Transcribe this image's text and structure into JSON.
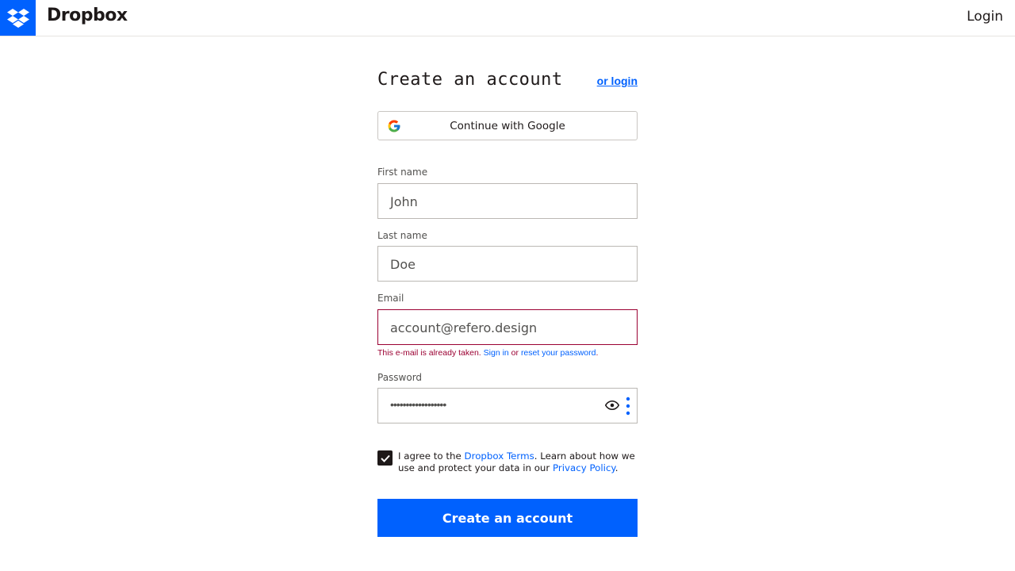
{
  "header": {
    "brand": "Dropbox",
    "login_label": "Login"
  },
  "form": {
    "title": "Create an account",
    "or_login": "or login",
    "google_button": "Continue with Google",
    "first_name": {
      "label": "First name",
      "value": "John"
    },
    "last_name": {
      "label": "Last name",
      "value": "Doe"
    },
    "email": {
      "label": "Email",
      "value": "account@refero.design",
      "error_prefix": "This e-mail is already taken.",
      "error_sign_in": "Sign in",
      "error_or": "or",
      "error_reset": "reset your password",
      "error_end": "."
    },
    "password": {
      "label": "Password",
      "value": "••••••••••••••••••"
    },
    "agree": {
      "text_1": "I agree to the ",
      "terms_link": "Dropbox Terms",
      "text_2": ". Learn about how we use and protect your data in our ",
      "privacy_link": "Privacy Policy",
      "text_3": ".",
      "checked": true
    },
    "submit_label": "Create an account"
  },
  "colors": {
    "accent": "#0061fe",
    "error": "#9b0032",
    "text": "#1e1919"
  },
  "icons": [
    "dropbox-logo-icon",
    "google-icon",
    "eye-icon",
    "kebab-icon",
    "checkmark-icon"
  ]
}
